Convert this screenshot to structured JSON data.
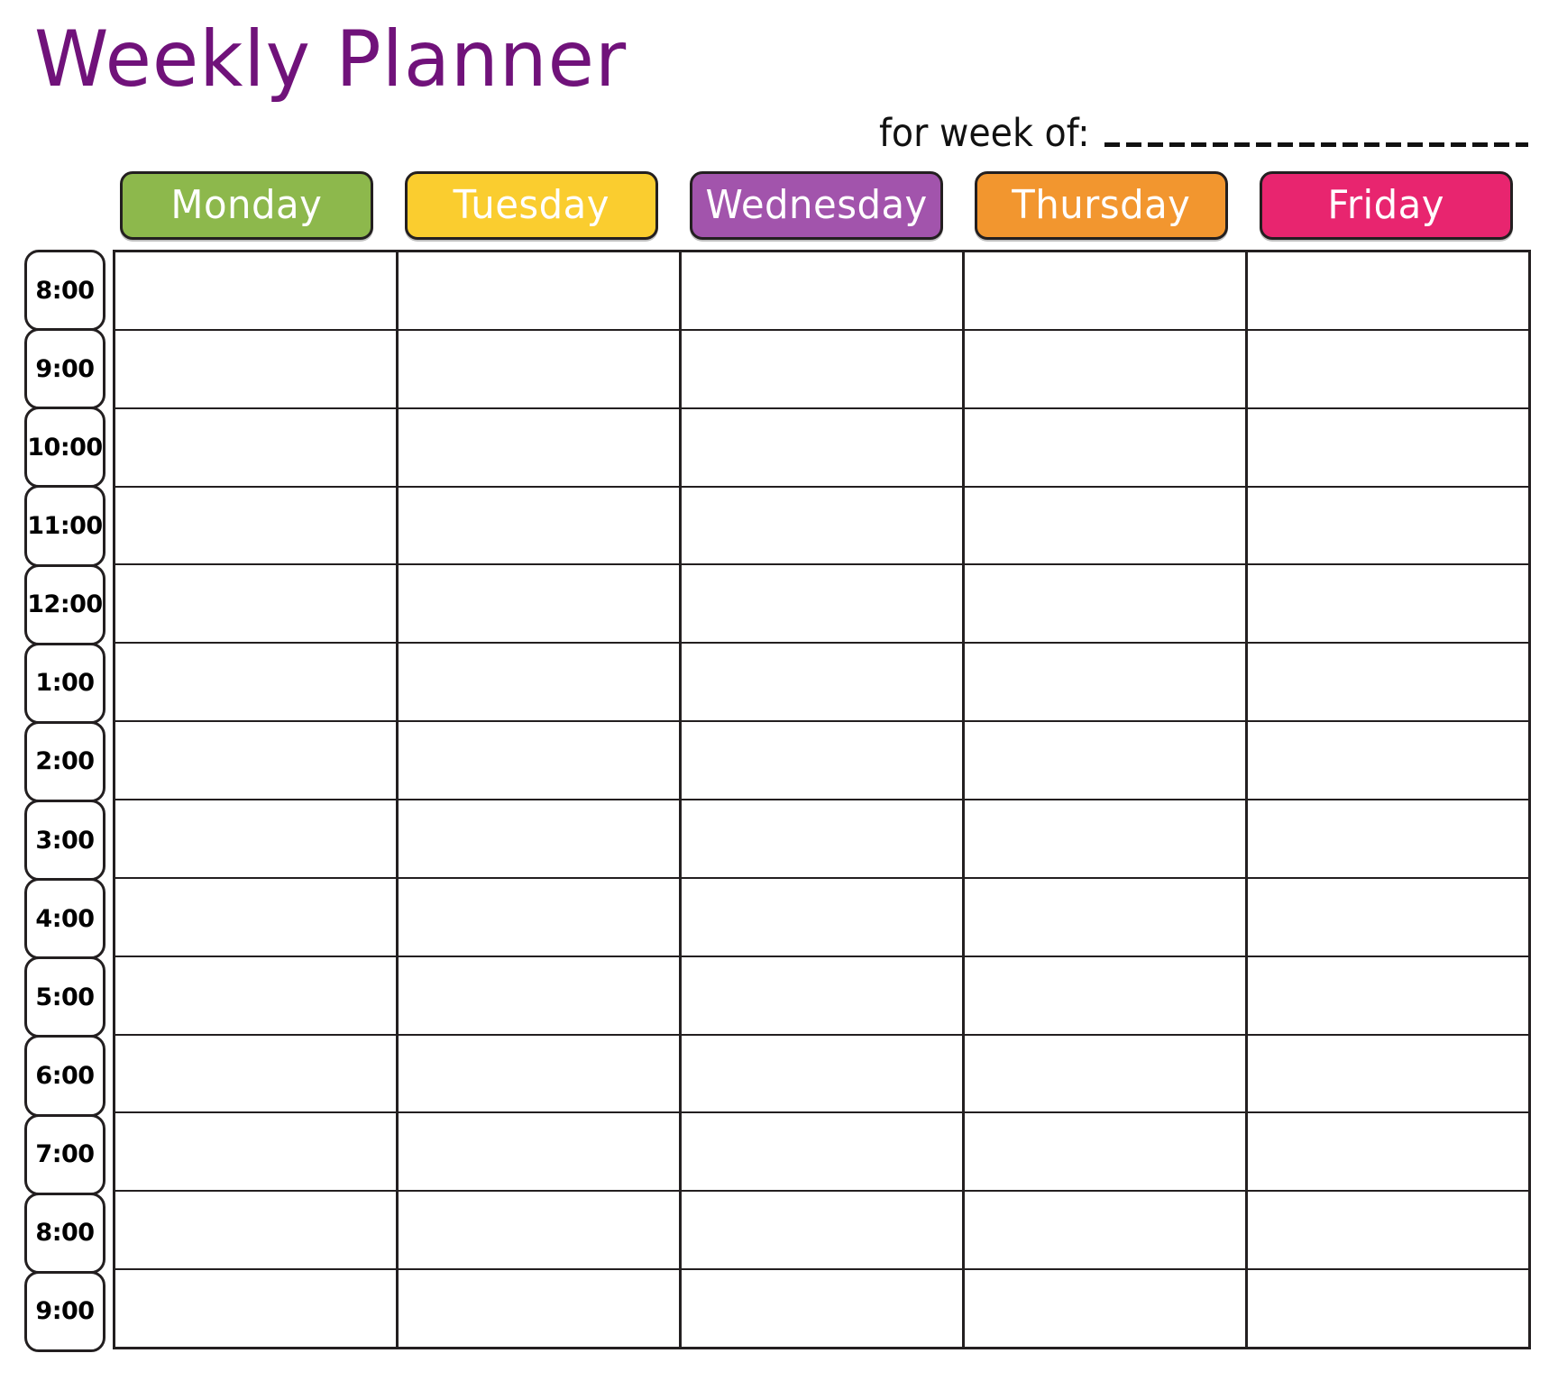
{
  "header": {
    "title": "Weekly Planner",
    "title_color": "#70127A",
    "week_of_label": "for week of:",
    "week_of_value": ""
  },
  "days": [
    {
      "label": "Monday",
      "color": "#8DB84C"
    },
    {
      "label": "Tuesday",
      "color": "#FACD2F"
    },
    {
      "label": "Wednesday",
      "color": "#A254AC"
    },
    {
      "label": "Thursday",
      "color": "#F2962F"
    },
    {
      "label": "Friday",
      "color": "#E8256F"
    }
  ],
  "times": [
    "8:00",
    "9:00",
    "10:00",
    "11:00",
    "12:00",
    "1:00",
    "2:00",
    "3:00",
    "4:00",
    "5:00",
    "6:00",
    "7:00",
    "8:00",
    "9:00"
  ],
  "grid": {
    "columns": 5,
    "rows": 14,
    "cells": [
      [
        "",
        "",
        "",
        "",
        ""
      ],
      [
        "",
        "",
        "",
        "",
        ""
      ],
      [
        "",
        "",
        "",
        "",
        ""
      ],
      [
        "",
        "",
        "",
        "",
        ""
      ],
      [
        "",
        "",
        "",
        "",
        ""
      ],
      [
        "",
        "",
        "",
        "",
        ""
      ],
      [
        "",
        "",
        "",
        "",
        ""
      ],
      [
        "",
        "",
        "",
        "",
        ""
      ],
      [
        "",
        "",
        "",
        "",
        ""
      ],
      [
        "",
        "",
        "",
        "",
        ""
      ],
      [
        "",
        "",
        "",
        "",
        ""
      ],
      [
        "",
        "",
        "",
        "",
        ""
      ],
      [
        "",
        "",
        "",
        "",
        ""
      ],
      [
        "",
        "",
        "",
        "",
        ""
      ]
    ]
  },
  "colors": {
    "ink": "#231f20",
    "page_background": "#ffffff",
    "time_text": "#000000",
    "day_label_text": "#ffffff"
  }
}
